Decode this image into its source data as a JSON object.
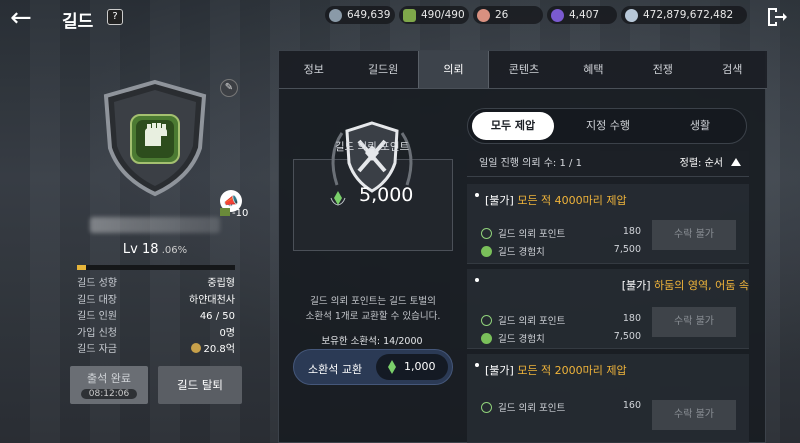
{
  "header": {
    "title": "길드",
    "help_icon": "help-icon"
  },
  "resources": [
    {
      "value": "649,639",
      "color": "#8a9aa8"
    },
    {
      "value": "490/490",
      "color": "#7fa84a"
    },
    {
      "value": "26",
      "color": "#d89080"
    },
    {
      "value": "4,407",
      "color": "#7a5ad0"
    },
    {
      "value": "472,879,672,482",
      "color": "#b8c8d8"
    }
  ],
  "guild": {
    "emblem": "fist-emblem-icon",
    "level": "Lv 18",
    "level_pct": " .06%",
    "exp_fraction": 0.06,
    "badge": "-10",
    "info": [
      {
        "k": "길드 성향",
        "v": "중립형"
      },
      {
        "k": "길드 대장",
        "v": "하얀대천사"
      },
      {
        "k": "길드 인원",
        "v": "46 / 50"
      },
      {
        "k": "가입 신청",
        "v": "0명"
      },
      {
        "k": "길드 자금",
        "v": "20.8억"
      }
    ],
    "attend_label": "출석 완료",
    "attend_time": "08:12:06",
    "leave_label": "길드 탈퇴"
  },
  "tabs": [
    "정보",
    "길드원",
    "의뢰",
    "콘텐츠",
    "혜택",
    "전쟁",
    "검색"
  ],
  "active_tab": 2,
  "points": {
    "title": "길드 의뢰 포인트",
    "value": "5,000",
    "desc1": "길드 의뢰 포인트는 길드 토벌의",
    "desc2": "소환석 1개로 교환할 수 있습니다.",
    "owned": "보유한 소환석: 14/2000",
    "exchange_label": "소환석 교환",
    "exchange_cost": "1,000"
  },
  "subtabs": [
    "모두 제압",
    "지정 수행",
    "생활"
  ],
  "quest_header": {
    "left": "일일 진행 의뢰 수: 1 / 1",
    "sort": "정렬: 순서"
  },
  "quests": [
    {
      "prefix": "[불가]",
      "title": " 모든 적 4000마리 제압",
      "rewards": [
        {
          "name": "길드 의뢰 포인트",
          "v": "180"
        },
        {
          "name": "길드 경험치",
          "v": "7,500"
        }
      ],
      "claim": "수락 불가"
    },
    {
      "prefix": "[불가]",
      "title": " 하둠의 영역, 어둠 속",
      "rewards": [
        {
          "name": "길드 의뢰 포인트",
          "v": "180"
        },
        {
          "name": "길드 경험치",
          "v": "7,500"
        }
      ],
      "claim": "수락 불가"
    },
    {
      "prefix": "[불가]",
      "title": " 모든 적 2000마리 제압",
      "rewards": [
        {
          "name": "길드 의뢰 포인트",
          "v": "160"
        }
      ],
      "claim": "수락 불가"
    }
  ]
}
